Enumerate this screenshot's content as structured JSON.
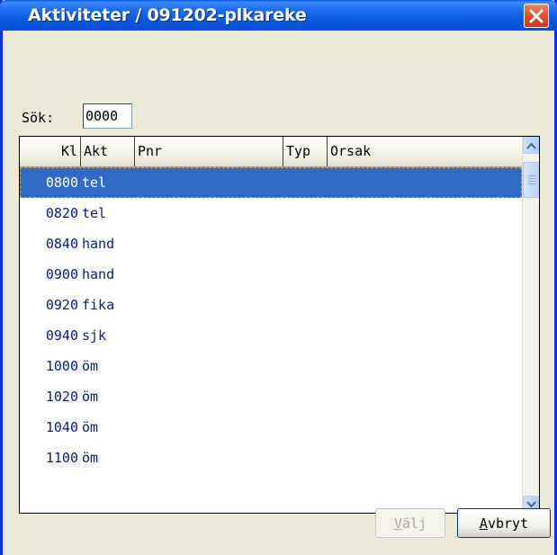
{
  "window": {
    "title": "Aktiviteter / 091202-plkareke",
    "close_icon": "close-icon"
  },
  "search": {
    "label": "Sök:",
    "value": "0000"
  },
  "grid": {
    "columns": [
      "Kl",
      "Akt",
      "Pnr",
      "Typ",
      "Orsak"
    ],
    "selected_index": 0,
    "rows": [
      {
        "kl": "0800",
        "akt": "tel",
        "pnr": "",
        "typ": "",
        "orsak": ""
      },
      {
        "kl": "0820",
        "akt": "tel",
        "pnr": "",
        "typ": "",
        "orsak": ""
      },
      {
        "kl": "0840",
        "akt": "hand",
        "pnr": "",
        "typ": "",
        "orsak": ""
      },
      {
        "kl": "0900",
        "akt": "hand",
        "pnr": "",
        "typ": "",
        "orsak": ""
      },
      {
        "kl": "0920",
        "akt": "fika",
        "pnr": "",
        "typ": "",
        "orsak": ""
      },
      {
        "kl": "0940",
        "akt": "sjk",
        "pnr": "",
        "typ": "",
        "orsak": ""
      },
      {
        "kl": "1000",
        "akt": "öm",
        "pnr": "",
        "typ": "",
        "orsak": ""
      },
      {
        "kl": "1020",
        "akt": "öm",
        "pnr": "",
        "typ": "",
        "orsak": ""
      },
      {
        "kl": "1040",
        "akt": "öm",
        "pnr": "",
        "typ": "",
        "orsak": ""
      },
      {
        "kl": "1100",
        "akt": "öm",
        "pnr": "",
        "typ": "",
        "orsak": ""
      }
    ]
  },
  "buttons": {
    "select_label": "Välj",
    "select_hotkey": "V",
    "select_enabled": false,
    "cancel_label": "Avbryt",
    "cancel_hotkey": "A"
  },
  "colors": {
    "titlebar": "#0a5fe8",
    "selection": "#316ac5",
    "row_text": "#0a1a86"
  }
}
